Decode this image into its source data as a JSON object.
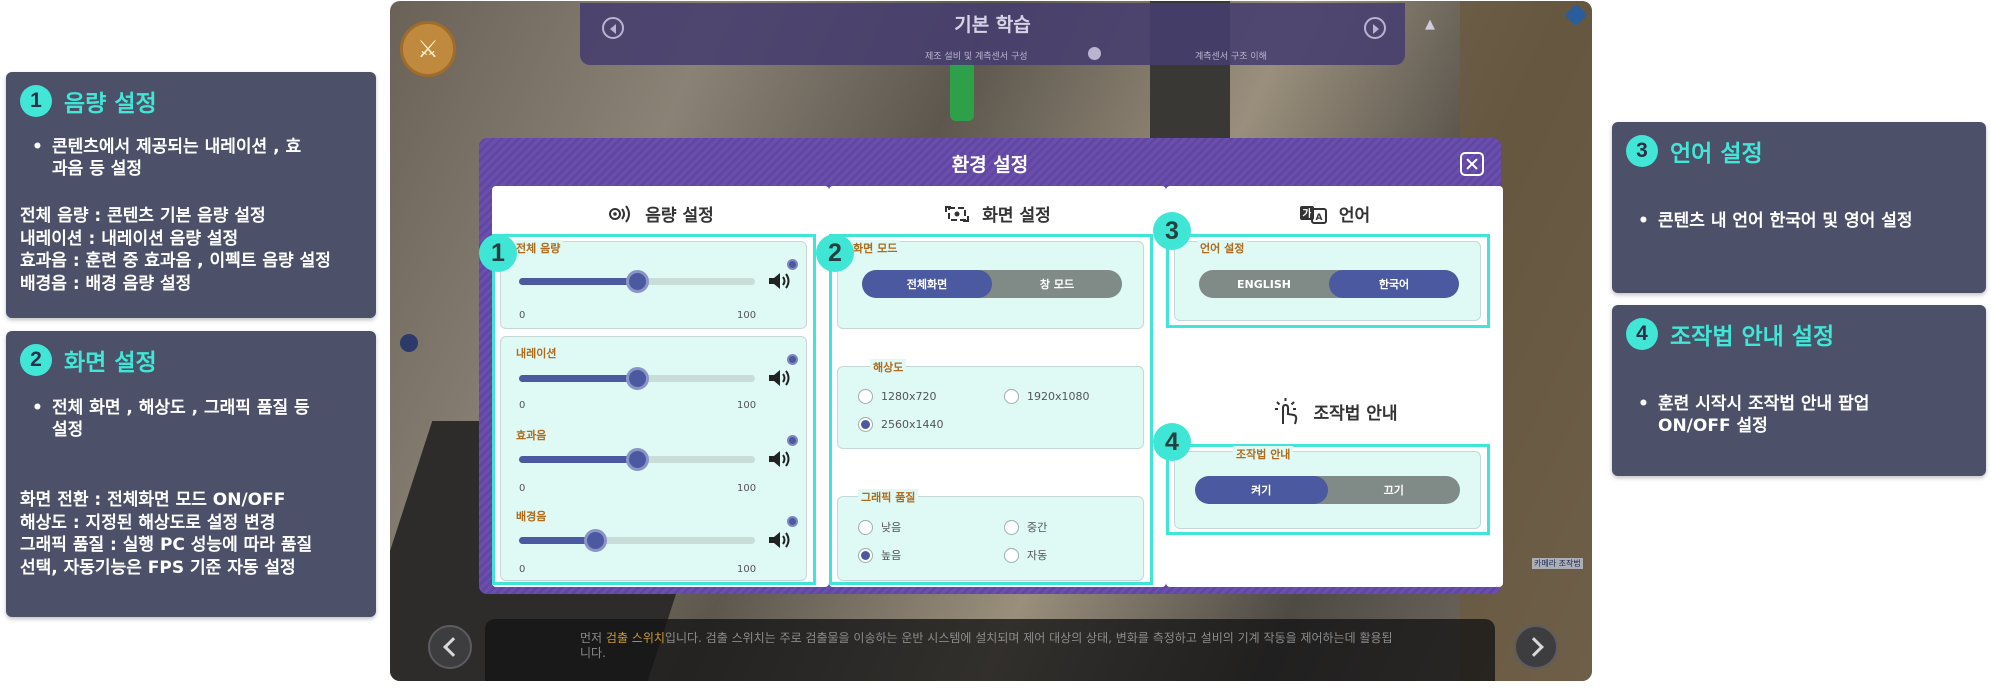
{
  "annotations": {
    "volume": {
      "number": "1",
      "title": "음량 설정",
      "bullet_line1": "콘텐츠에서 제공되는 내레이션 ,  효",
      "bullet_line2": "과음 등 설정",
      "desc": "전체 음량  : 콘텐츠 기본 음량 설정\n내레이션  :  내레이션 음량 설정\n효과음  :  훈련 중 효과음 ,  이펙트 음량 설정\n배경음  :  배경 음량 설정"
    },
    "screen": {
      "number": "2",
      "title": "화면 설정",
      "bullet_line1": "전체 화면 ,  해상도 ,  그래픽 품질 등",
      "bullet_line2": "설정",
      "desc": "화면 전환 : 전체화면 모드 ON/OFF\n해상도  :  지정된 해상도로 설정 변경\n그래픽 품질  :  실행 PC 성능에 따라 품질\n선택, 자동기능은 FPS 기준 자동 설정"
    },
    "language": {
      "number": "3",
      "title": "언어 설정",
      "bullet": "콘텐츠 내  언어 한국어 및 영어 설정"
    },
    "controls": {
      "number": "4",
      "title": "조작법 안내 설정",
      "bullet_line1": "훈련 시작시 조작법 안내 팝업",
      "bullet_line2": "ON/OFF 설정"
    }
  },
  "game": {
    "top_title": "기본 학습",
    "sub_left": "제조 설비 및 계측센서 구성",
    "sub_right": "계측센서 구조 이해",
    "logo_glyph": "⚔",
    "small_label": "카메라 조작법",
    "bottom_text_pre": "먼저 ",
    "bottom_text_highlight": "검출 스위치",
    "bottom_text_post": "입니다. 검출 스위치는 주로 검출물을 이송하는 운반 시스템에 설치되며 제어 대상의 상태, 변화를 측정하고 설비의 기계 작동을 제어하는데 활용됩니다."
  },
  "dialog": {
    "title": "환경 설정",
    "volume_panel": {
      "heading": "음량 설정",
      "marker": "1",
      "min_label": "0",
      "max_label": "100",
      "sliders": [
        {
          "label": "전체 음량",
          "value": 50
        },
        {
          "label": "내레이션",
          "value": 50
        },
        {
          "label": "효과음",
          "value": 50
        },
        {
          "label": "배경음",
          "value": 32
        }
      ]
    },
    "screen_panel": {
      "heading": "화면 설정",
      "marker": "2",
      "mode_label": "화면 모드",
      "mode_options": [
        "전체화면",
        "창 모드"
      ],
      "mode_selected": "전체화면",
      "resolution_label": "해상도",
      "resolutions": [
        "1280x720",
        "1920x1080",
        "2560x1440"
      ],
      "resolution_selected": "2560x1440",
      "quality_label": "그래픽 품질",
      "qualities": [
        "낮음",
        "중간",
        "높음",
        "자동"
      ],
      "quality_selected": "높음"
    },
    "language_panel": {
      "heading": "언어",
      "marker": "3",
      "section_label": "언어 설정",
      "options": [
        "ENGLISH",
        "한국어"
      ],
      "selected": "한국어"
    },
    "controls_panel": {
      "heading": "조작법 안내",
      "marker": "4",
      "section_label": "조작법 안내",
      "options": [
        "켜기",
        "끄기"
      ],
      "selected": "켜기"
    }
  },
  "colors": {
    "accent_teal": "#3fe6d6",
    "selected_blue": "#4b5aa0",
    "dialog_purple": "#6b4fae",
    "card_bg": "#4c5068"
  }
}
